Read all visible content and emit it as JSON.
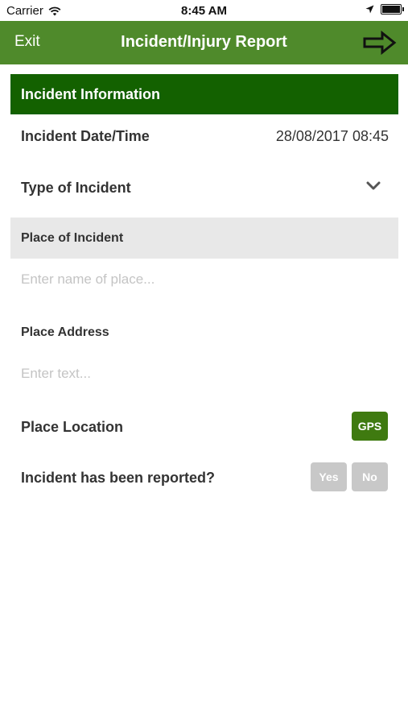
{
  "status_bar": {
    "carrier": "Carrier",
    "time": "8:45 AM"
  },
  "nav": {
    "exit_label": "Exit",
    "title": "Incident/Injury Report",
    "next_icon": "arrow-right-icon"
  },
  "section": {
    "title": "Incident Information"
  },
  "fields": {
    "incident_datetime_label": "Incident Date/Time",
    "incident_datetime_value": "28/08/2017 08:45",
    "type_of_incident_label": "Type of Incident",
    "place_of_incident_label": "Place of Incident",
    "place_name_placeholder": "Enter name of place...",
    "place_address_label": "Place Address",
    "place_address_placeholder": "Enter text...",
    "place_location_label": "Place Location",
    "gps_label": "GPS",
    "reported_label": "Incident has been reported?",
    "yes_label": "Yes",
    "no_label": "No"
  },
  "colors": {
    "nav_bg": "#4f8a2b",
    "section_bg": "#136100",
    "gps_bg": "#3f7a10",
    "toggle_bg": "#c8c8c8"
  }
}
